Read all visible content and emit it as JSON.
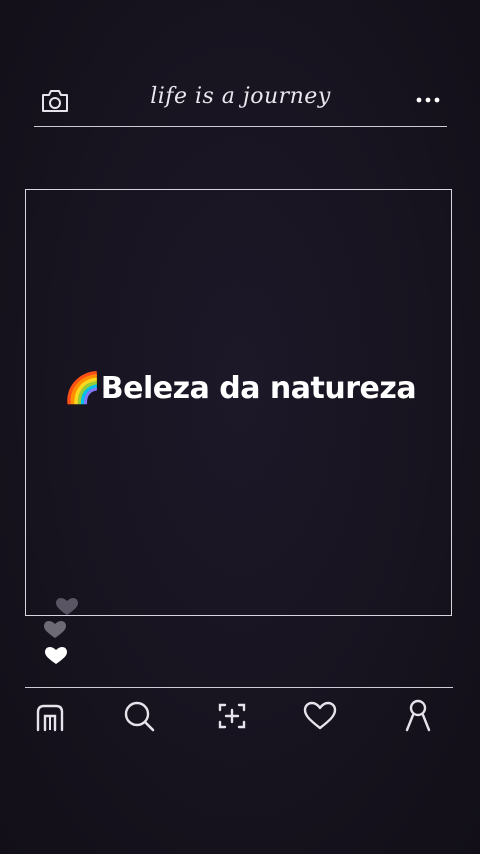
{
  "header": {
    "title": "life is a journey",
    "camera_icon": "camera-icon",
    "more_icon": "more-horizontal-icon"
  },
  "post": {
    "caption": "🌈Beleza da natureza"
  },
  "reactions": {
    "icons": [
      "heart-icon",
      "heart-icon",
      "heart-icon"
    ]
  },
  "nav": {
    "items": [
      {
        "icon": "home-icon"
      },
      {
        "icon": "search-icon"
      },
      {
        "icon": "add-post-icon"
      },
      {
        "icon": "heart-icon"
      },
      {
        "icon": "profile-icon"
      }
    ]
  },
  "colors": {
    "background": "#17131f",
    "line": "#cfcbd6",
    "text": "#ffffff"
  }
}
